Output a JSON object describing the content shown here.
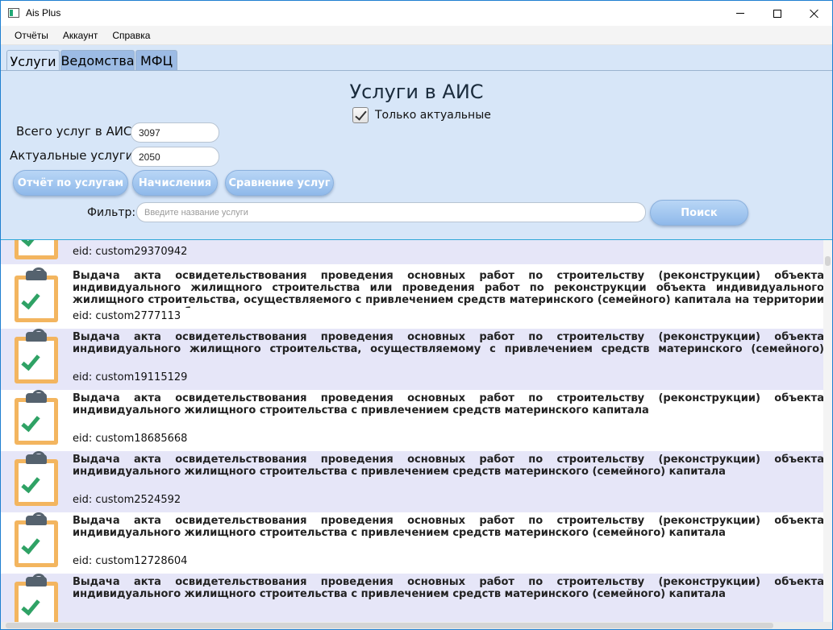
{
  "window": {
    "title": "Ais Plus",
    "minimize": "minimize",
    "maximize": "maximize",
    "close": "close"
  },
  "menu": [
    "Отчёты",
    "Аккаунт",
    "Справка"
  ],
  "tabs": [
    {
      "label": "Услуги",
      "active": true
    },
    {
      "label": "Ведомства",
      "active": false
    },
    {
      "label": "МФЦ",
      "active": false
    }
  ],
  "header": {
    "title": "Услуги в АИС",
    "only_actual_label": "Только актуальные",
    "only_actual_checked": true,
    "total_label": "Всего услуг в АИС:",
    "total_value": "3097",
    "actual_label": "Актуальные услуги:",
    "actual_value": "2050",
    "btn_report": "Отчёт по услугам",
    "btn_charges": "Начисления",
    "btn_compare": "Сравнение услуг",
    "filter_label": "Фильтр:",
    "filter_placeholder": "Введите название услуги",
    "btn_search": "Поиск"
  },
  "services": [
    {
      "title": "",
      "eid": "eid: custom29370942"
    },
    {
      "title": "Выдача акта освидетельствования проведения основных работ по строительству (реконструкции) объекта индивидуального жилищного строительства или проведения работ по реконструкции объекта индивидуального жилищного строительства, осуществляемого с привлечением средств материнского (семейного) капитала на территории муниципального образования",
      "eid": "eid: custom2777113"
    },
    {
      "title": "Выдача акта освидетельствования проведения основных работ по строительству (реконструкции) объекта индивидуального жилищного строительства, осуществляемому с привлечением средств материнского (семейного) капитала",
      "eid": "eid: custom19115129"
    },
    {
      "title": "Выдача акта освидетельствования проведения основных работ по строительству (реконструкции) объекта индивидуального жилищного строительства с привлечением средств материнского капитала",
      "eid": "eid: custom18685668"
    },
    {
      "title": "Выдача акта освидетельствования проведения основных работ по строительству (реконструкции) объекта индивидуального жилищного строительства с привлечением средств материнского (семейного) капитала",
      "eid": "eid: custom2524592"
    },
    {
      "title": "Выдача акта освидетельствования проведения основных работ по строительству (реконструкции) объекта индивидуального жилищного строительства с привлечением средств материнского (семейного) капитала",
      "eid": "eid: custom12728604"
    },
    {
      "title": "Выдача акта освидетельствования проведения основных работ по строительству (реконструкции) объекта индивидуального жилищного строительства с привлечением средств материнского (семейного) капитала",
      "eid": ""
    }
  ],
  "colors": {
    "panel_bg": "#d7e6f8",
    "inactive_tab": "#9cbbe4",
    "row_alt": "#e6e6f8",
    "clipboard": "#f3b55f",
    "check": "#2fa265",
    "accent_border": "#2fa8d8"
  }
}
